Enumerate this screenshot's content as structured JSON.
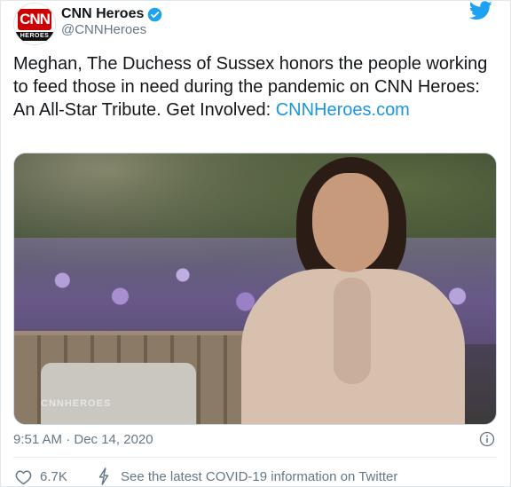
{
  "author": {
    "avatar_logo": "CNN",
    "avatar_sub": "HEROES",
    "display_name": "CNN Heroes",
    "handle": "@CNNHeroes",
    "verified": true,
    "verified_icon": "verified-badge-icon"
  },
  "platform": {
    "logo_icon": "twitter-bird-icon",
    "color": "#1da1f2"
  },
  "tweet": {
    "text": "Meghan, The Duchess of Sussex honors the people working to feed those in need during the pandemic on CNN Heroes: An All-Star Tribute. Get Involved:",
    "link": "CNNHeroes.com",
    "link_color": "#1b95e0"
  },
  "media": {
    "watermark": "CNNHEROES"
  },
  "meta": {
    "timestamp": "9:51 AM · Dec 14, 2020",
    "info_icon": "info-icon"
  },
  "actions": {
    "like_icon": "heart-icon",
    "like_count": "6.7K",
    "covid_icon": "lightning-icon",
    "covid_text": "See the latest COVID-19 information on Twitter"
  },
  "colors": {
    "text": "#14171a",
    "secondary": "#657786",
    "accent": "#1da1f2",
    "brand_red": "#cc0000"
  }
}
